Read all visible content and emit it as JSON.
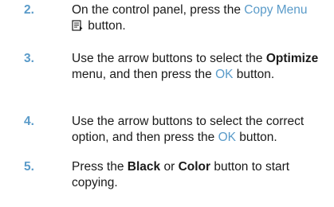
{
  "steps": [
    {
      "number": "2.",
      "parts": {
        "a": "On the control panel, press the ",
        "b": "Copy Menu",
        "c": " button."
      }
    },
    {
      "number": "3.",
      "parts": {
        "a": "Use the arrow buttons to select the ",
        "b": "Optimize",
        "c": " menu, and then press the ",
        "d": "OK",
        "e": " button."
      }
    },
    {
      "number": "4.",
      "parts": {
        "a": "Use the arrow buttons to select the correct option, and then press the ",
        "b": "OK",
        "c": " button."
      }
    },
    {
      "number": "5.",
      "parts": {
        "a": "Press the ",
        "b": "Black",
        "c": " or ",
        "d": "Color",
        "e": " button to start copying."
      }
    }
  ],
  "icons": {
    "copy_menu": "copy-menu-icon"
  },
  "colors": {
    "accent": "#5a9bc9",
    "text": "#1a1a1a"
  }
}
